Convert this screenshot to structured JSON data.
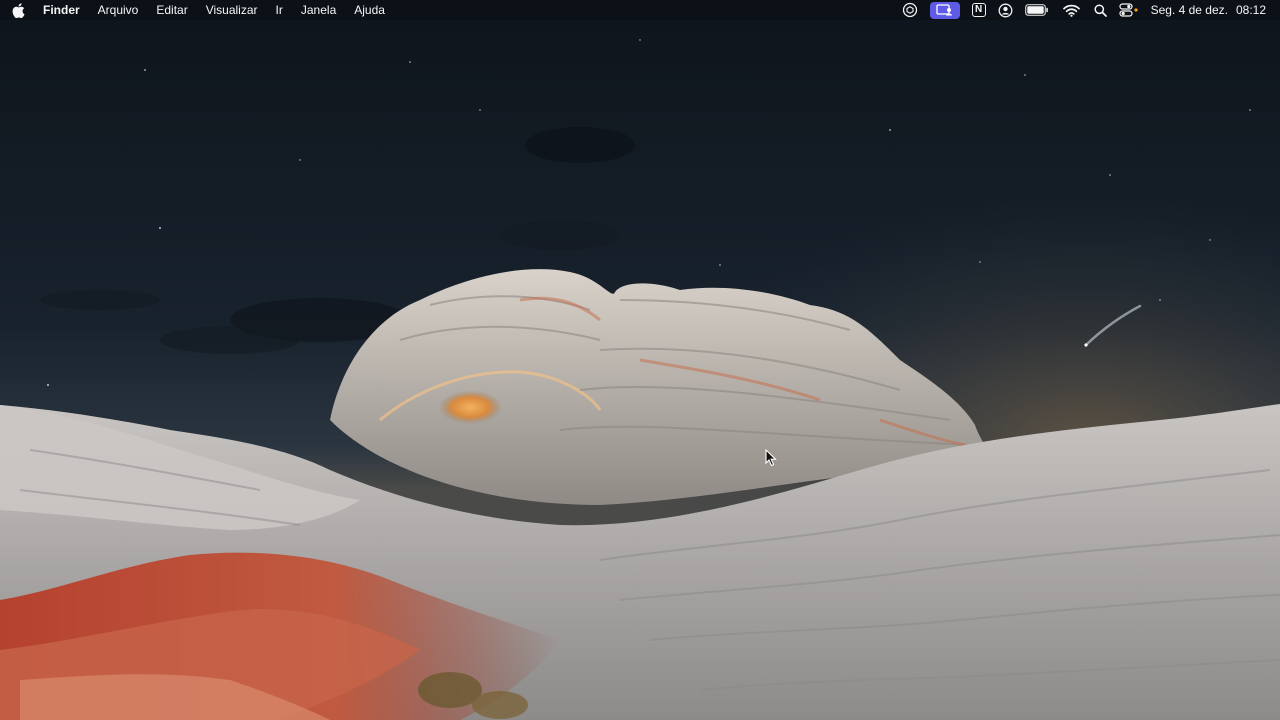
{
  "menubar": {
    "apple_icon": "apple-logo-icon",
    "app_name": "Finder",
    "menus": [
      "Arquivo",
      "Editar",
      "Visualizar",
      "Ir",
      "Janela",
      "Ajuda"
    ],
    "status_icons": [
      "chatgpt-icon",
      "screen-share-icon",
      "notion-icon",
      "user-account-icon",
      "battery-icon",
      "wifi-icon",
      "search-icon",
      "control-center-icon"
    ],
    "date": "Seg. 4 de dez.",
    "time": "08:12"
  },
  "wallpaper": {
    "name": "desert-rock-night-wallpaper",
    "sky_color": "#121a24",
    "rock_color": "#b9b3ad",
    "glow_color": "#e39a45",
    "red_rock_color": "#a04530"
  },
  "accent": "#5e5ce6"
}
